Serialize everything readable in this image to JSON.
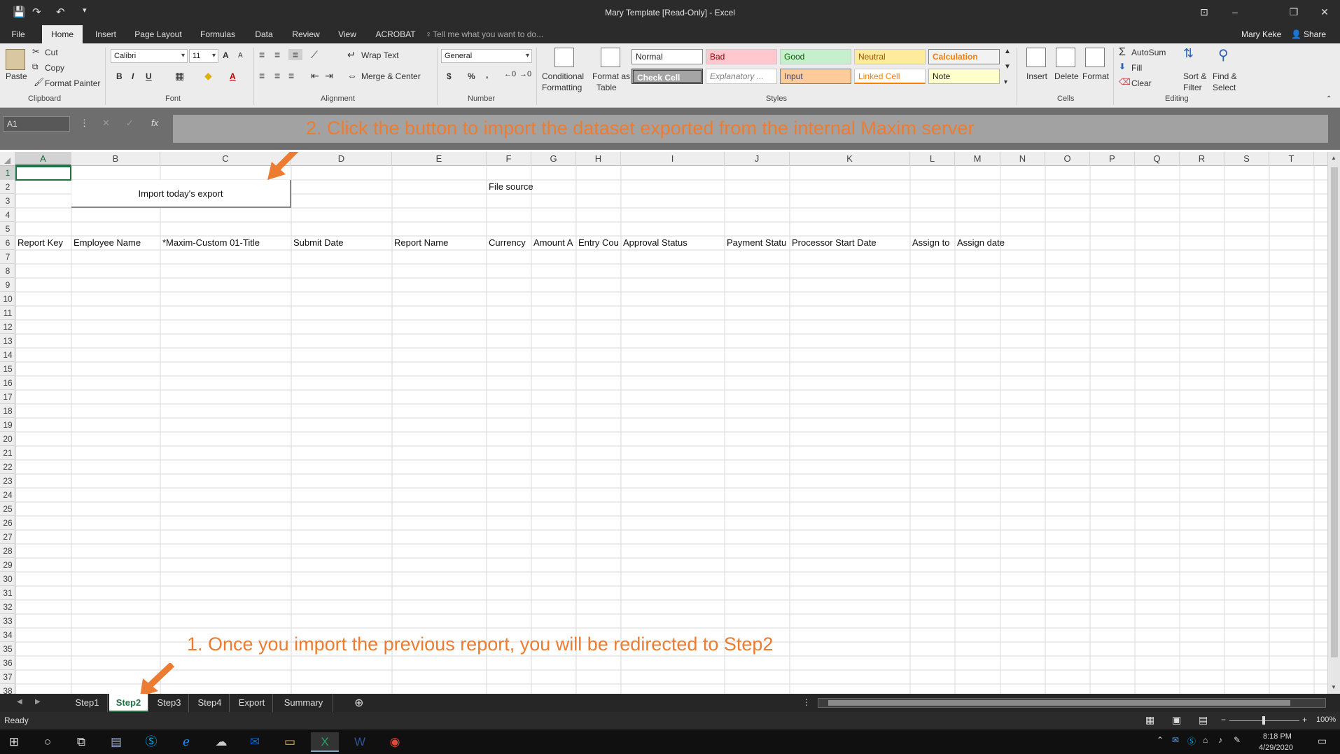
{
  "window": {
    "title": "Mary Template  [Read-Only] - Excel"
  },
  "ribbon_tabs": [
    "File",
    "Home",
    "Insert",
    "Page Layout",
    "Formulas",
    "Data",
    "Review",
    "View",
    "ACROBAT"
  ],
  "tell_me": "Tell me what you want to do...",
  "user": "Mary Keke",
  "share_label": "Share",
  "clipboard": {
    "paste": "Paste",
    "cut": "Cut",
    "copy": "Copy",
    "format_painter": "Format Painter",
    "group": "Clipboard"
  },
  "font": {
    "name": "Calibri",
    "size": "11",
    "group": "Font",
    "bold": "B",
    "italic": "I",
    "underline": "U",
    "grow": "A",
    "shrink": "A",
    "color": "A"
  },
  "alignment": {
    "wrap": "Wrap Text",
    "merge": "Merge & Center",
    "group": "Alignment"
  },
  "number": {
    "format": "General",
    "currency": "$",
    "percent": "%",
    "comma": ",",
    "group": "Number"
  },
  "styles": {
    "conditional_1": "Conditional",
    "conditional_2": "Formatting",
    "format_table_1": "Format as",
    "format_table_2": "Table",
    "normal": "Normal",
    "bad": "Bad",
    "good": "Good",
    "neutral": "Neutral",
    "calculation": "Calculation",
    "check_cell": "Check Cell",
    "explanatory": "Explanatory ...",
    "input": "Input",
    "linked_cell": "Linked Cell",
    "note": "Note",
    "group": "Styles"
  },
  "cells_grp": {
    "insert": "Insert",
    "delete": "Delete",
    "format": "Format",
    "group": "Cells"
  },
  "editing": {
    "autosum": "AutoSum",
    "fill": "Fill",
    "clear": "Clear",
    "sort_1": "Sort &",
    "sort_2": "Filter",
    "find_1": "Find &",
    "find_2": "Select",
    "group": "Editing"
  },
  "name_box": "A1",
  "fx_label": "fx",
  "annotations": {
    "top": "2. Click the button to import the dataset exported from the internal Maxim server",
    "bottom": "1. Once you import the previous report, you will be redirected to Step2"
  },
  "columns": [
    "A",
    "B",
    "C",
    "D",
    "E",
    "F",
    "G",
    "H",
    "I",
    "J",
    "K",
    "L",
    "M",
    "N",
    "O",
    "P",
    "Q",
    "R",
    "S",
    "T"
  ],
  "rows": [
    "1",
    "2",
    "3",
    "4",
    "5",
    "6",
    "7",
    "8",
    "9",
    "10",
    "11",
    "12",
    "13",
    "14",
    "15",
    "16",
    "17",
    "18",
    "19",
    "20",
    "21",
    "22",
    "23",
    "24",
    "25",
    "26",
    "27",
    "28",
    "29",
    "30",
    "31",
    "32",
    "33",
    "34",
    "35",
    "36",
    "37",
    "38"
  ],
  "import_button": "Import today's export",
  "file_source": "File source",
  "headers": [
    "Report Key",
    "Employee Name",
    "*Maxim-Custom 01-Title",
    "Submit Date",
    "Report Name",
    "Currency",
    "Amount A",
    "Entry Cou",
    "Approval Status",
    "Payment Statu",
    "Processor Start Date",
    "Assign to",
    "Assign date"
  ],
  "sheets": [
    "Step1",
    "Step2",
    "Step3",
    "Step4",
    "Export",
    "Summary"
  ],
  "status": {
    "ready": "Ready",
    "zoom": "100%"
  },
  "taskbar": {
    "time": "8:18 PM",
    "date": "4/29/2020"
  }
}
